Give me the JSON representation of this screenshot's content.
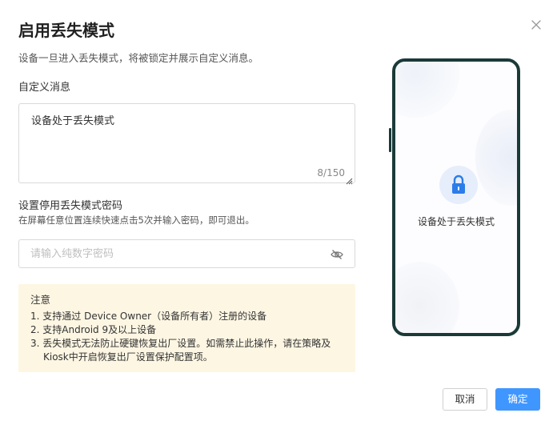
{
  "dialog": {
    "title": "启用丢失模式",
    "description": "设备一旦进入丢失模式，将被锁定并展示自定义消息。",
    "close_icon": "close-icon"
  },
  "message": {
    "label": "自定义消息",
    "value": "设备处于丢失模式",
    "counter": "8/150"
  },
  "password": {
    "label": "设置停用丢失模式密码",
    "hint": "在屏幕任意位置连续快速点击5次并输入密码，即可退出。",
    "placeholder": "请输入纯数字密码",
    "value": "",
    "toggle_icon": "eye-off-icon"
  },
  "notice": {
    "title": "注意",
    "items": [
      "1. 支持通过 Device Owner（设备所有者）注册的设备",
      "2. 支持Android 9及以上设备",
      "3. 丢失模式无法防止硬键恢复出厂设置。如需禁止此操作，请在策略及",
      "Kiosk中开启恢复出厂设置保护配置项。"
    ]
  },
  "preview": {
    "lock_icon": "lock-icon",
    "text": "设备处于丢失模式",
    "accent": "#2b7de9"
  },
  "footer": {
    "cancel_label": "取消",
    "ok_label": "确定",
    "ok_color": "#4096ff"
  }
}
